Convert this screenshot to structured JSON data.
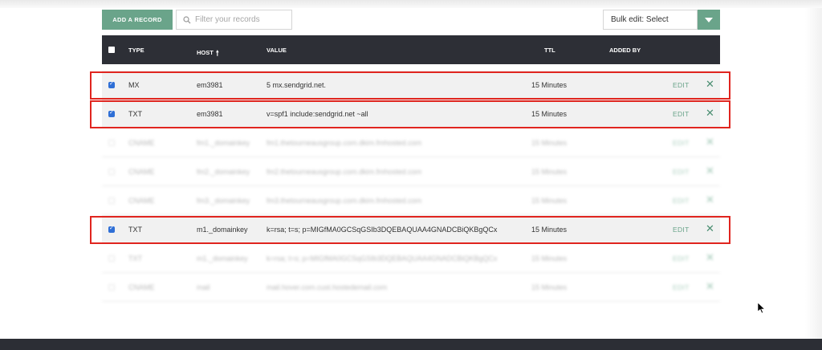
{
  "toolbar": {
    "add_record_label": "ADD A RECORD",
    "filter_placeholder": "Filter your records",
    "bulk_edit_label": "Bulk edit: Select"
  },
  "table": {
    "columns": [
      "TYPE",
      "HOST",
      "VALUE",
      "TTL",
      "ADDED BY"
    ],
    "edit_label": "EDIT",
    "rows": [
      {
        "type": "MX",
        "host": "em3981",
        "value": "5 mx.sendgrid.net.",
        "ttl": "15 Minutes",
        "checked": true,
        "highlighted": true
      },
      {
        "type": "TXT",
        "host": "em3981",
        "value": "v=spf1 include:sendgrid.net ~all",
        "ttl": "15 Minutes",
        "checked": true,
        "highlighted": true
      },
      {
        "type": "CNAME",
        "host": "fm1._domainkey",
        "value": "fm1.thetourneausgroup.com.dkim.fmhosted.com",
        "ttl": "15 Minutes",
        "checked": false,
        "highlighted": false
      },
      {
        "type": "CNAME",
        "host": "fm2._domainkey",
        "value": "fm2.thetourneausgroup.com.dkim.fmhosted.com",
        "ttl": "15 Minutes",
        "checked": false,
        "highlighted": false
      },
      {
        "type": "CNAME",
        "host": "fm3._domainkey",
        "value": "fm3.thetourneausgroup.com.dkim.fmhosted.com",
        "ttl": "15 Minutes",
        "checked": false,
        "highlighted": false
      },
      {
        "type": "TXT",
        "host": "m1._domainkey",
        "value": "k=rsa; t=s; p=MIGfMA0GCSqGSIb3DQEBAQUAA4GNADCBiQKBgQCx",
        "ttl": "15 Minutes",
        "checked": true,
        "highlighted": true
      },
      {
        "type": "TXT",
        "host": "m1._domainkey",
        "value": "k=rsa; t=s; p=MIGfMA0GCSqGSIb3DQEBAQUAA4GNADCBiQKBgQCx",
        "ttl": "15 Minutes",
        "checked": false,
        "highlighted": false
      },
      {
        "type": "CNAME",
        "host": "mail",
        "value": "mail.hover.com.cust.hostedemail.com",
        "ttl": "15 Minutes",
        "checked": false,
        "highlighted": false
      }
    ]
  },
  "colors": {
    "accent": "#6aa48a",
    "header_bg": "#2d2f36",
    "highlight_border": "#e0251f",
    "checkbox_checked": "#2f6fd6"
  }
}
